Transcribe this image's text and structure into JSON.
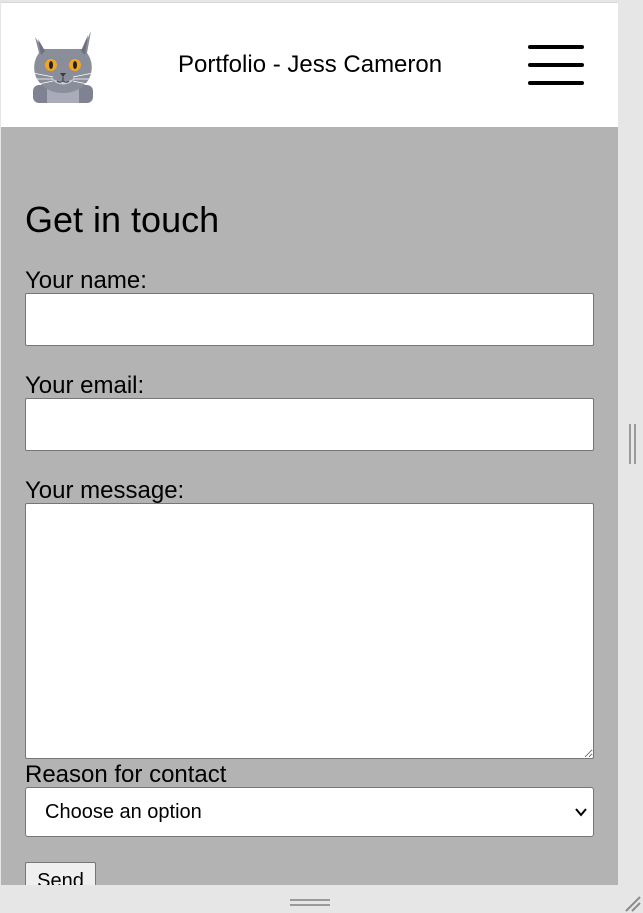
{
  "header": {
    "site_title": "Portfolio - Jess Cameron",
    "logo_icon": "cat-logo-icon",
    "menu_icon": "hamburger-menu-icon"
  },
  "form": {
    "heading": "Get in touch",
    "name_label": "Your name:",
    "name_value": "",
    "email_label": "Your email:",
    "email_value": "",
    "message_label": "Your message:",
    "message_value": "",
    "reason_label": "Reason for contact",
    "reason_selected": "Choose an option",
    "send_label": "Send"
  },
  "colors": {
    "page_background": "#b3b3b3",
    "header_background": "#ffffff",
    "frame_background": "#e6e6e6"
  }
}
